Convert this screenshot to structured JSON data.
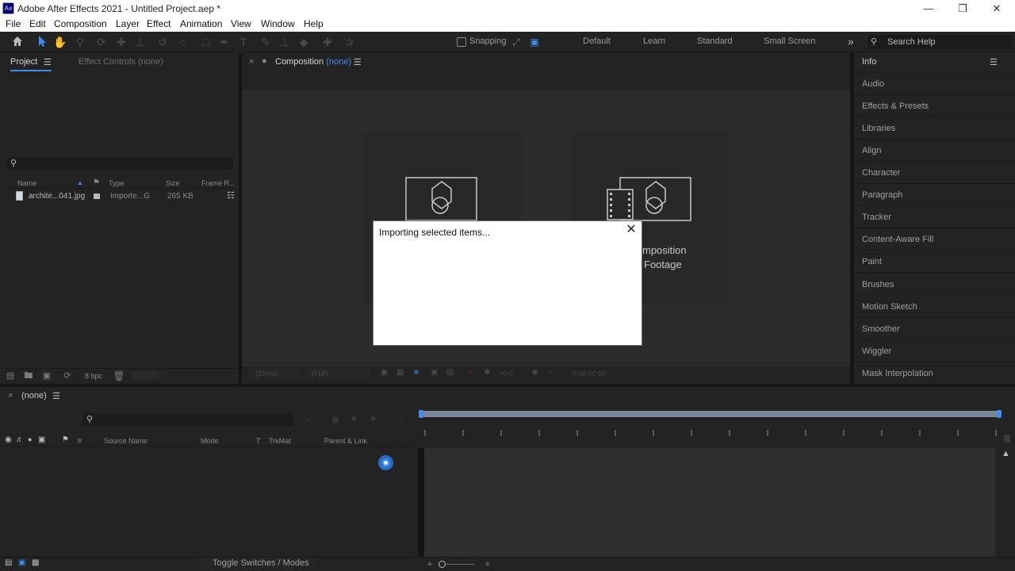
{
  "window": {
    "app_logo": "Ae",
    "title": "Adobe After Effects 2021 - Untitled Project.aep *",
    "minimize_icon": "minimize-icon",
    "restore_icon": "restore-icon",
    "close_icon": "close-icon"
  },
  "menu": [
    "File",
    "Edit",
    "Composition",
    "Layer",
    "Effect",
    "Animation",
    "View",
    "Window",
    "Help"
  ],
  "toolbar": {
    "snapping_label": "Snapping",
    "workspaces": [
      "Default",
      "Learn",
      "Standard",
      "Small Screen"
    ],
    "more_icon": "chevron-double-right-icon",
    "search_placeholder": "Search Help"
  },
  "project_panel": {
    "tab_project": "Project",
    "tab_effect_controls": "Effect Controls",
    "tab_effect_controls_value": "(none)",
    "columns": [
      "Name",
      "Type",
      "Size",
      "Frame R..."
    ],
    "items": [
      {
        "name": "archite...041.jpg",
        "type": "Importe...G",
        "size": "265 KB"
      }
    ],
    "bpc_label": "8 bpc"
  },
  "composition_panel": {
    "tab_label": "Composition",
    "tab_value": "(none)",
    "card_right_line1": "mposition",
    "card_right_line2": "Footage",
    "footer_zoom": "(100%)",
    "footer_res": "(Full)",
    "footer_exposure": "+0.0",
    "footer_timecode": "0:00:00:00"
  },
  "info_panel": {
    "items": [
      "Info",
      "Audio",
      "Effects & Presets",
      "Libraries",
      "Align",
      "Character",
      "Paragraph",
      "Tracker",
      "Content-Aware Fill",
      "Paint",
      "Brushes",
      "Motion Sketch",
      "Smoother",
      "Wiggler",
      "Mask Interpolation"
    ]
  },
  "timeline": {
    "tab_label": "(none)",
    "columns": [
      "#",
      "Source Name",
      "Mode",
      "T",
      "TrkMat",
      "Parent & Link"
    ],
    "toggle_label": "Toggle Switches / Modes"
  },
  "dialog": {
    "message": "Importing selected items...",
    "close_icon": "close-icon"
  },
  "colors": {
    "accent_blue": "#3d8df5",
    "panel_bg": "#232323",
    "comp_bg": "#2b2b2b",
    "dialog_bg": "#ffffff"
  }
}
